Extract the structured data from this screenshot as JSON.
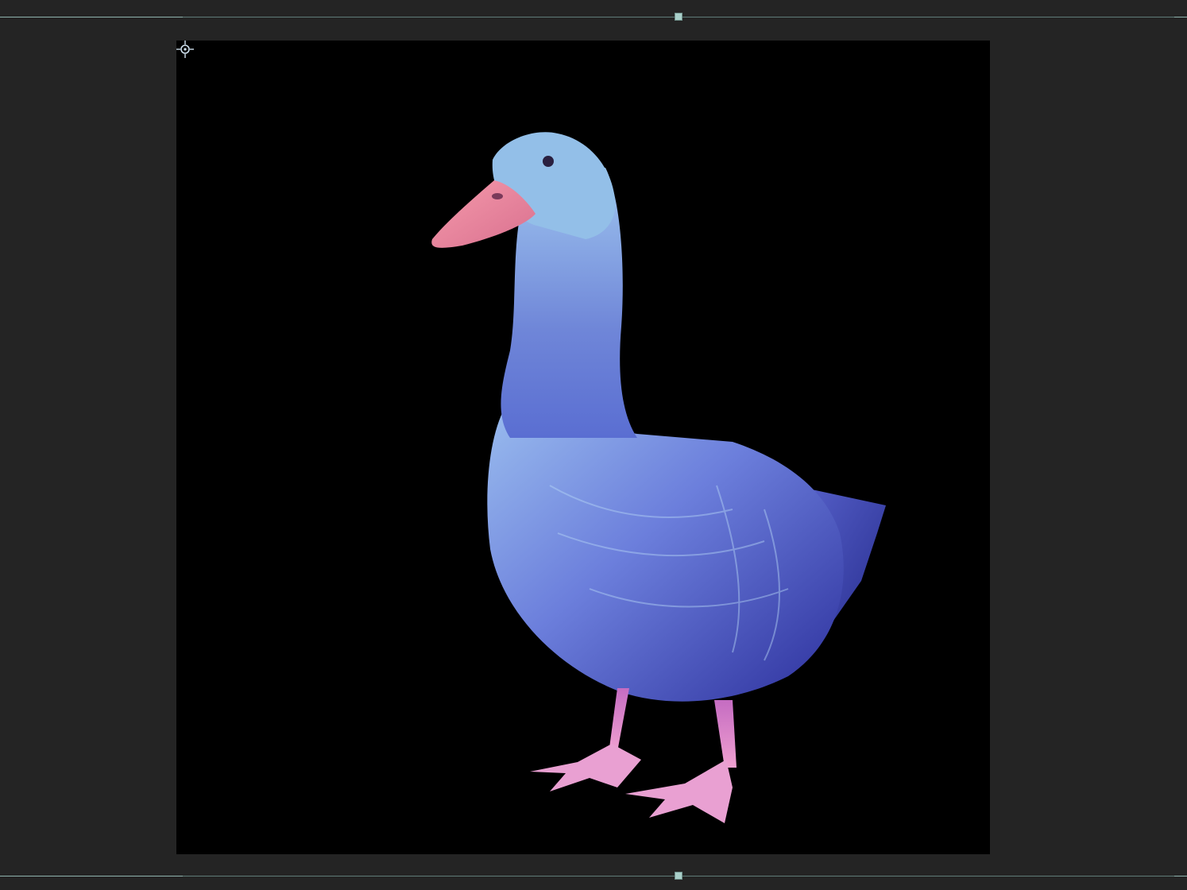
{
  "viewer": {
    "subject": "goose-3d-render",
    "background_color": "#242424",
    "canvas_color": "#000000",
    "guide_color": "#8fb3ad",
    "handle_color": "#a9d0ca"
  },
  "icons": {
    "anchor": "anchor-point-icon",
    "handle": "guide-handle-icon"
  },
  "colors": {
    "body_light": "#8fb4e8",
    "body_mid": "#5d6fd6",
    "body_dark": "#2a2f9a",
    "beak": "#f08aa0",
    "legs": "#e78fc1"
  }
}
